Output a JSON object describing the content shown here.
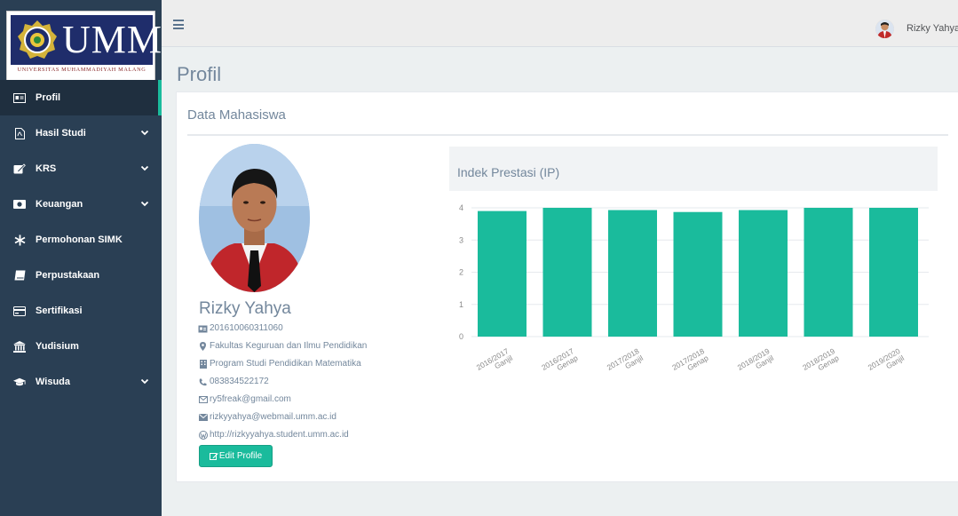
{
  "sidebar": {
    "logo_text": "UMM",
    "logo_subtitle": "UNIVERSITAS MUHAMMADIYAH MALANG",
    "items": [
      {
        "label": "Profil",
        "icon": "id-card-icon",
        "has_caret": false,
        "active": true
      },
      {
        "label": "Hasil Studi",
        "icon": "document-icon",
        "has_caret": true,
        "active": false
      },
      {
        "label": "KRS",
        "icon": "edit-icon",
        "has_caret": true,
        "active": false
      },
      {
        "label": "Keuangan",
        "icon": "money-icon",
        "has_caret": true,
        "active": false
      },
      {
        "label": "Permohonan SIMK",
        "icon": "snowflake-icon",
        "has_caret": false,
        "active": false
      },
      {
        "label": "Perpustakaan",
        "icon": "book-icon",
        "has_caret": false,
        "active": false
      },
      {
        "label": "Sertifikasi",
        "icon": "credit-card-icon",
        "has_caret": false,
        "active": false
      },
      {
        "label": "Yudisium",
        "icon": "institution-icon",
        "has_caret": false,
        "active": false
      },
      {
        "label": "Wisuda",
        "icon": "graduation-cap-icon",
        "has_caret": true,
        "active": false
      }
    ]
  },
  "topnav": {
    "user_name": "Rizky Yahya"
  },
  "page": {
    "title": "Profil"
  },
  "panel": {
    "title": "Data Mahasiswa"
  },
  "profile": {
    "name": "Rizky Yahya",
    "nim": "201610060311060",
    "faculty": "Fakultas Keguruan dan Ilmu Pendidikan",
    "program": "Program Studi Pendidikan Matematika",
    "phone": "083834522172",
    "email": "ry5freak@gmail.com",
    "webmail": "rizkyyahya@webmail.umm.ac.id",
    "website": "http://rizkyyahya.student.umm.ac.id",
    "edit_label": "Edit Profile"
  },
  "colors": {
    "sidebar": "#2a3f54",
    "accent": "#1abb9c",
    "bar": "#1abb9c",
    "text_muted": "#73879c"
  },
  "chart_data": {
    "type": "bar",
    "title": "Indek Prestasi (IP)",
    "categories": [
      [
        "2016/2017",
        "Ganjil"
      ],
      [
        "2016/2017",
        "Genap"
      ],
      [
        "2017/2018",
        "Ganjil"
      ],
      [
        "2017/2018",
        "Genap"
      ],
      [
        "2018/2019",
        "Ganjil"
      ],
      [
        "2018/2019",
        "Genap"
      ],
      [
        "2019/2020",
        "Ganjil"
      ]
    ],
    "values": [
      3.9,
      4.0,
      3.93,
      3.87,
      3.93,
      4.0,
      4.0
    ],
    "ylim": [
      0,
      4
    ],
    "yticks": [
      0,
      1,
      2,
      3,
      4
    ],
    "grid": true
  }
}
